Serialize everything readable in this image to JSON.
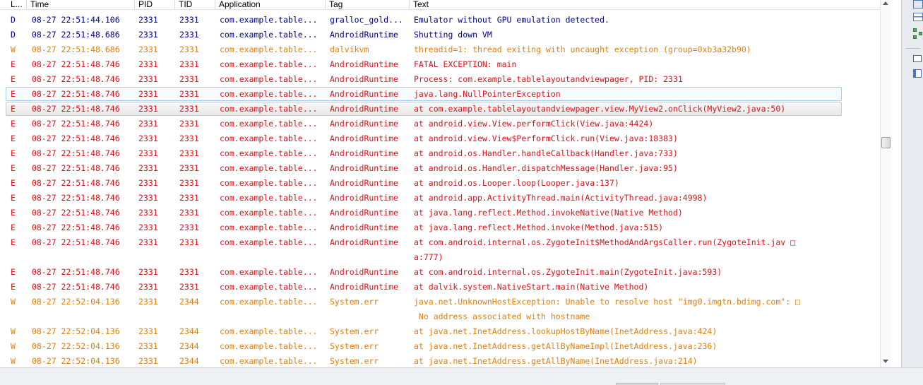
{
  "columns": {
    "level": "L...",
    "time": "Time",
    "pid": "PID",
    "tid": "TID",
    "application": "Application",
    "tag": "Tag",
    "text": "Text"
  },
  "rows": [
    {
      "level": "D",
      "time": "08-27 22:51:44.106",
      "pid": "2331",
      "tid": "2331",
      "application": "com.example.table...",
      "tag": "gralloc_gold...",
      "text": "Emulator without GPU emulation detected."
    },
    {
      "level": "D",
      "time": "08-27 22:51:48.686",
      "pid": "2331",
      "tid": "2331",
      "application": "com.example.table...",
      "tag": "AndroidRuntime",
      "text": "Shutting down VM"
    },
    {
      "level": "W",
      "time": "08-27 22:51:48.686",
      "pid": "2331",
      "tid": "2331",
      "application": "com.example.table...",
      "tag": "dalvikvm",
      "text": "threadid=1: thread exiting with uncaught exception (group=0xb3a32b90)"
    },
    {
      "level": "E",
      "time": "08-27 22:51:48.746",
      "pid": "2331",
      "tid": "2331",
      "application": "com.example.table...",
      "tag": "AndroidRuntime",
      "text": "FATAL EXCEPTION: main"
    },
    {
      "level": "E",
      "time": "08-27 22:51:48.746",
      "pid": "2331",
      "tid": "2331",
      "application": "com.example.table...",
      "tag": "AndroidRuntime",
      "text": "Process: com.example.tablelayoutandviewpager, PID: 2331"
    },
    {
      "level": "E",
      "time": "08-27 22:51:48.746",
      "pid": "2331",
      "tid": "2331",
      "application": "com.example.table...",
      "tag": "AndroidRuntime",
      "text": "java.lang.NullPointerException",
      "state": "selected"
    },
    {
      "level": "E",
      "time": "08-27 22:51:48.746",
      "pid": "2331",
      "tid": "2331",
      "application": "com.example.table...",
      "tag": "AndroidRuntime",
      "text": "at com.example.tablelayoutandviewpager.view.MyView2.onClick(MyView2.java:50)",
      "state": "hover"
    },
    {
      "level": "E",
      "time": "08-27 22:51:48.746",
      "pid": "2331",
      "tid": "2331",
      "application": "com.example.table...",
      "tag": "AndroidRuntime",
      "text": "at android.view.View.performClick(View.java:4424)"
    },
    {
      "level": "E",
      "time": "08-27 22:51:48.746",
      "pid": "2331",
      "tid": "2331",
      "application": "com.example.table...",
      "tag": "AndroidRuntime",
      "text": "at android.view.View$PerformClick.run(View.java:18383)"
    },
    {
      "level": "E",
      "time": "08-27 22:51:48.746",
      "pid": "2331",
      "tid": "2331",
      "application": "com.example.table...",
      "tag": "AndroidRuntime",
      "text": "at android.os.Handler.handleCallback(Handler.java:733)"
    },
    {
      "level": "E",
      "time": "08-27 22:51:48.746",
      "pid": "2331",
      "tid": "2331",
      "application": "com.example.table...",
      "tag": "AndroidRuntime",
      "text": "at android.os.Handler.dispatchMessage(Handler.java:95)"
    },
    {
      "level": "E",
      "time": "08-27 22:51:48.746",
      "pid": "2331",
      "tid": "2331",
      "application": "com.example.table...",
      "tag": "AndroidRuntime",
      "text": "at android.os.Looper.loop(Looper.java:137)"
    },
    {
      "level": "E",
      "time": "08-27 22:51:48.746",
      "pid": "2331",
      "tid": "2331",
      "application": "com.example.table...",
      "tag": "AndroidRuntime",
      "text": "at android.app.ActivityThread.main(ActivityThread.java:4998)"
    },
    {
      "level": "E",
      "time": "08-27 22:51:48.746",
      "pid": "2331",
      "tid": "2331",
      "application": "com.example.table...",
      "tag": "AndroidRuntime",
      "text": "at java.lang.reflect.Method.invokeNative(Native Method)"
    },
    {
      "level": "E",
      "time": "08-27 22:51:48.746",
      "pid": "2331",
      "tid": "2331",
      "application": "com.example.table...",
      "tag": "AndroidRuntime",
      "text": "at java.lang.reflect.Method.invoke(Method.java:515)"
    },
    {
      "level": "E",
      "time": "08-27 22:51:48.746",
      "pid": "2331",
      "tid": "2331",
      "application": "com.example.table...",
      "tag": "AndroidRuntime",
      "text": "at com.android.internal.os.ZygoteInit$MethodAndArgsCaller.run(ZygoteInit.jav □",
      "continuation": "a:777)"
    },
    {
      "level": "E",
      "time": "08-27 22:51:48.746",
      "pid": "2331",
      "tid": "2331",
      "application": "com.example.table...",
      "tag": "AndroidRuntime",
      "text": "at com.android.internal.os.ZygoteInit.main(ZygoteInit.java:593)"
    },
    {
      "level": "E",
      "time": "08-27 22:51:48.746",
      "pid": "2331",
      "tid": "2331",
      "application": "com.example.table...",
      "tag": "AndroidRuntime",
      "text": "at dalvik.system.NativeStart.main(Native Method)"
    },
    {
      "level": "W",
      "time": "08-27 22:52:04.136",
      "pid": "2331",
      "tid": "2344",
      "application": "com.example.table...",
      "tag": "System.err",
      "text": "java.net.UnknownHostException: Unable to resolve host \"img0.imgtn.bdimg.com\": □",
      "continuation": " No address associated with hostname"
    },
    {
      "level": "W",
      "time": "08-27 22:52:04.136",
      "pid": "2331",
      "tid": "2344",
      "application": "com.example.table...",
      "tag": "System.err",
      "text": "at java.net.InetAddress.lookupHostByName(InetAddress.java:424)"
    },
    {
      "level": "W",
      "time": "08-27 22:52:04.136",
      "pid": "2331",
      "tid": "2344",
      "application": "com.example.table...",
      "tag": "System.err",
      "text": "at java.net.InetAddress.getAllByNameImpl(InetAddress.java:236)"
    },
    {
      "level": "W",
      "time": "08-27 22:52:04.136",
      "pid": "2331",
      "tid": "2344",
      "application": "com.example.table...",
      "tag": "System.err",
      "text": "at java.net.InetAddress.getAllByName(InetAddress.java:214)"
    }
  ],
  "level_colors": {
    "D": "#00008b",
    "W": "#e08010",
    "E": "#d8141a"
  },
  "icons": [
    "console-icon",
    "tasks-icon",
    "hierarchy-icon",
    "restore-icon",
    "maximize-icon"
  ]
}
